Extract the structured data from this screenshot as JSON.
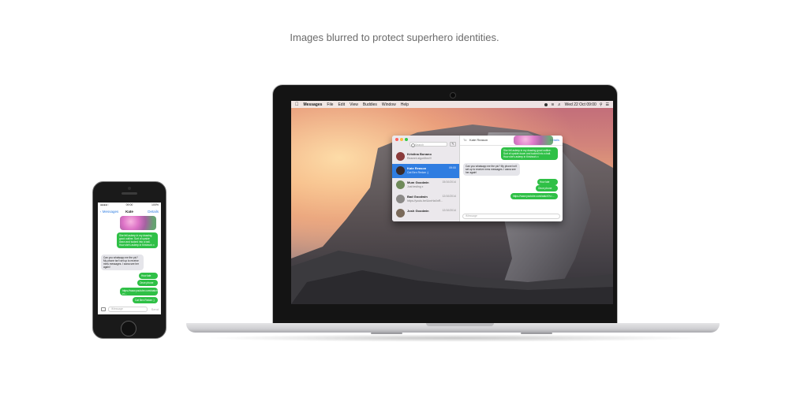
{
  "caption": "Images blurred to protect superhero identities.",
  "mac": {
    "menubar": {
      "app": "Messages",
      "items": [
        "File",
        "Edit",
        "View",
        "Buddies",
        "Window",
        "Help"
      ],
      "clock": "Wed 22 Oct  09:00"
    },
    "messages_window": {
      "search_placeholder": "Search",
      "conversations": [
        {
          "name": "Kristina Bonano",
          "preview": "Rearent algorithm!!!",
          "time": "",
          "selected": false,
          "avatar_color": "#8a3b3b"
        },
        {
          "name": "Kate Reason",
          "preview": "Cat Ben Redan ;)",
          "time": "09:00",
          "selected": true,
          "avatar_color": "#3a2b2b"
        },
        {
          "name": "Mum Goodwin",
          "preview": "Just testing x",
          "time": "15/10/2014",
          "selected": false,
          "avatar_color": "#6f8a5a"
        },
        {
          "name": "Bad Goodwin",
          "preview": "https://youtu.be/UcnHaXnR...",
          "time": "12/10/2014",
          "selected": false,
          "avatar_color": "#8c8a88"
        },
        {
          "name": "Josh Goodwin",
          "preview": "",
          "time": "12/10/2014",
          "selected": false,
          "avatar_color": "#7a6a5a"
        }
      ],
      "to_label": "To:",
      "to_name": "Kate Reason",
      "details": "Details",
      "bubbles": [
        {
          "text": "She fell asleep in my drawing good outline. Sort of upside down and tucked into a ball. How she's asleep in Krishna's x",
          "kind": "green"
        },
        {
          "text": "Can you whatsapp me the pic? My phone isn't set up to receive mms messages. I wana see her again!",
          "kind": "gray"
        },
        {
          "text": "How late",
          "kind": "green"
        },
        {
          "text": "Once phone",
          "kind": "green"
        },
        {
          "text": "https://www.youtube.com/watch?v=...",
          "kind": "green"
        }
      ],
      "input_placeholder": "iMessage"
    }
  },
  "phone": {
    "status": {
      "carrier": "●●●●○",
      "time": "09:00",
      "battery": "100%"
    },
    "nav": {
      "back": "Messages",
      "title": "Kate",
      "details": "Details"
    },
    "bubbles": [
      {
        "text": "She fell asleep in my drawing good outline. Sort of upside down and tucked into a ball. How she's asleep in Krishna's x",
        "kind": "green"
      },
      {
        "text": "Can you whatsapp me the pic? My phone isn't set up to receive mms messages. I wana see her again!",
        "kind": "gray"
      },
      {
        "text": "How late",
        "kind": "green"
      },
      {
        "text": "Once phone",
        "kind": "green"
      },
      {
        "text": "https://www.youtube.com/watch?v=...",
        "kind": "green"
      },
      {
        "text": "Cat Ben Redan ;)",
        "kind": "green"
      }
    ],
    "input_placeholder": "iMessage",
    "send": "Send"
  }
}
